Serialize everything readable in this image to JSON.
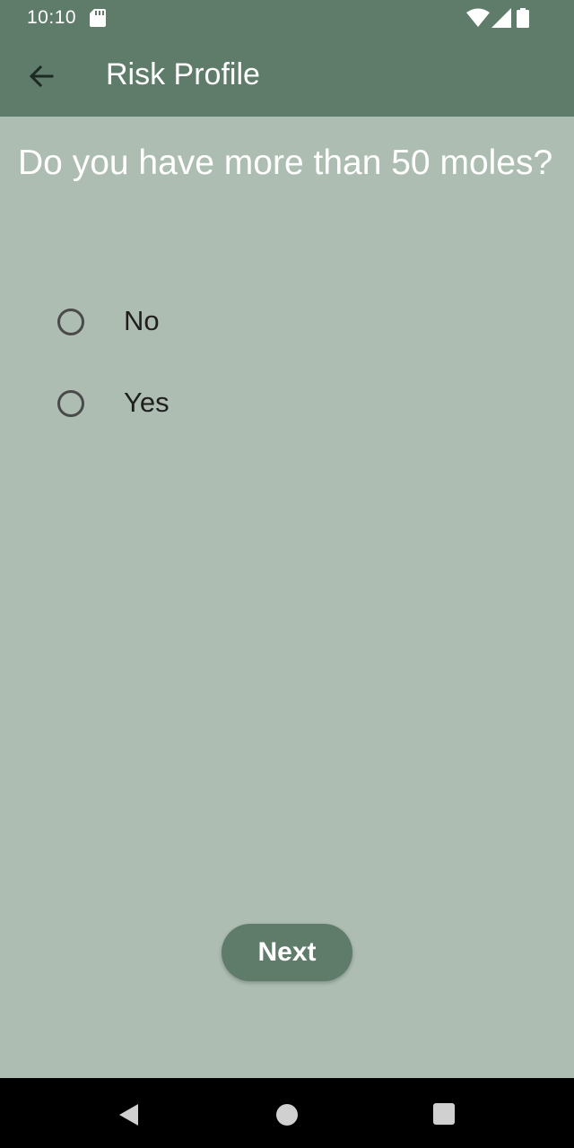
{
  "status_bar": {
    "time": "10:10",
    "icons": [
      "sd-card-icon",
      "wifi-icon",
      "cell-signal-icon",
      "battery-icon"
    ]
  },
  "app_bar": {
    "title": "Risk Profile",
    "back_icon": "arrow-back-icon"
  },
  "question": {
    "text": "Do you have more than 50 moles?"
  },
  "options": [
    {
      "label": "No",
      "selected": false
    },
    {
      "label": "Yes",
      "selected": false
    }
  ],
  "next_button": {
    "label": "Next"
  },
  "nav_bar": {
    "icons": [
      "nav-back-icon",
      "nav-home-icon",
      "nav-recents-icon"
    ]
  },
  "colors": {
    "primary": "#5f7c6b",
    "background": "#adbdb2",
    "on_primary": "#ffffff",
    "nav_background": "#000000"
  }
}
